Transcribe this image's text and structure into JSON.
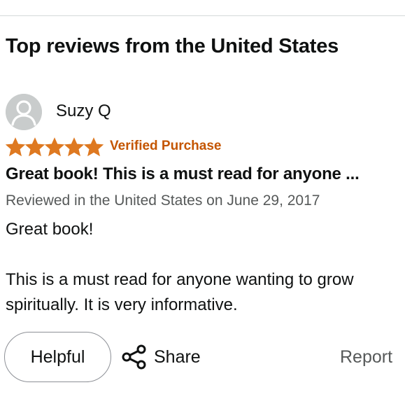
{
  "reviews_section": {
    "title": "Top reviews from the United States"
  },
  "review": {
    "reviewer_name": "Suzy Q",
    "avatar_icon": "user-silhouette-icon",
    "rating": 5,
    "rating_max": 5,
    "star_color": "#de7921",
    "verified_label": "Verified Purchase",
    "verified_color": "#c45500",
    "title": "Great book! This is a must read for anyone ...",
    "date_line": "Reviewed in the United States on June 29, 2017",
    "body": [
      "Great book!",
      "This is a must read for anyone wanting to grow spiritually. It is very informative."
    ]
  },
  "actions": {
    "helpful_label": "Helpful",
    "share_label": "Share",
    "share_icon": "share-icon",
    "report_label": "Report"
  }
}
